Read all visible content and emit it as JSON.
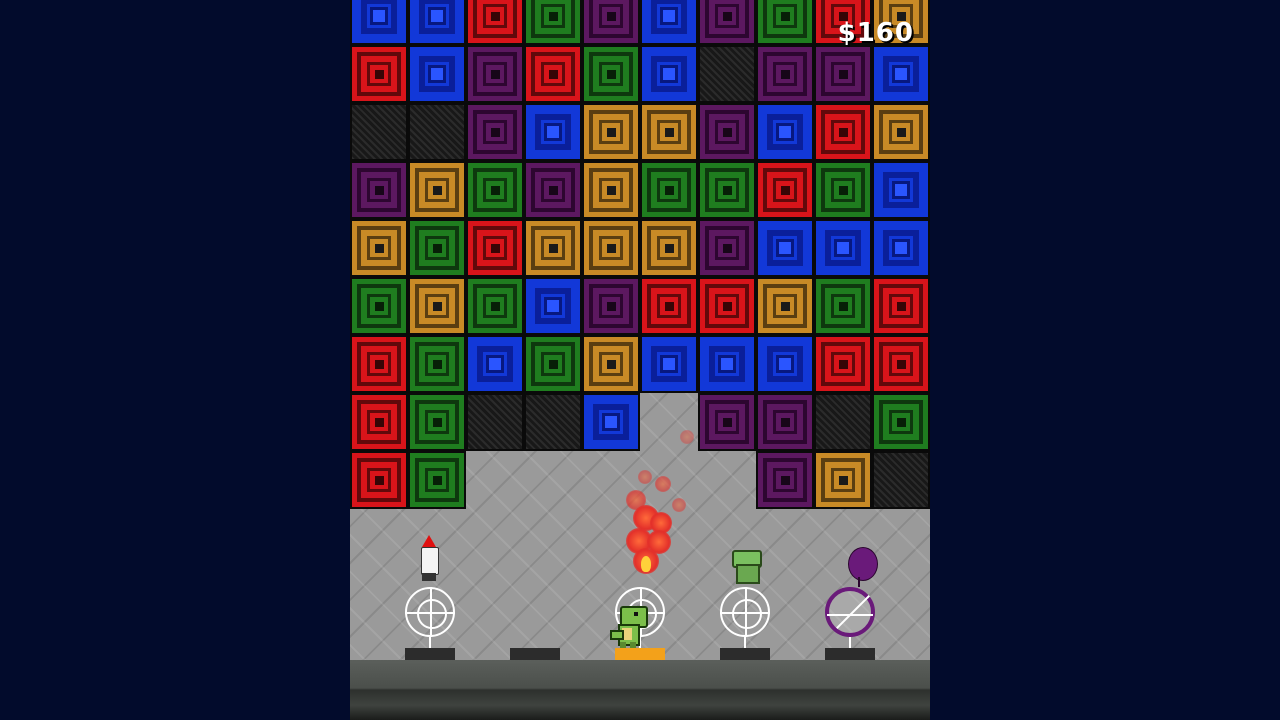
{
  "hud": {
    "money": "$160"
  },
  "tile_colors": {
    "r": "#d8141a",
    "g": "#1f7d1f",
    "b": "#1238d8",
    "p": "#5c1860",
    "o": "#c88a26",
    "x": "#1e1e1e"
  },
  "grid": [
    [
      "b",
      "b",
      "r",
      "g",
      "p",
      "b",
      "p",
      "g",
      "r",
      "o"
    ],
    [
      "r",
      "b",
      "p",
      "r",
      "g",
      "b",
      "x",
      "p",
      "p",
      "b"
    ],
    [
      "x",
      "x",
      "p",
      "b",
      "o",
      "o",
      "p",
      "b",
      "r",
      "o"
    ],
    [
      "p",
      "o",
      "g",
      "p",
      "o",
      "g",
      "g",
      "r",
      "g",
      "b"
    ],
    [
      "o",
      "g",
      "r",
      "o",
      "o",
      "o",
      "p",
      "b",
      "b",
      "b"
    ],
    [
      "g",
      "o",
      "g",
      "b",
      "p",
      "r",
      "r",
      "o",
      "g",
      "r"
    ],
    [
      "r",
      "g",
      "b",
      "g",
      "o",
      "b",
      "b",
      "b",
      "r",
      "r"
    ],
    [
      "r",
      "g",
      "x",
      "x",
      "b",
      "",
      "p",
      "p",
      "x",
      "g"
    ],
    [
      "r",
      "g",
      "",
      "",
      "",
      "",
      "",
      "p",
      "o",
      "x"
    ]
  ],
  "powerups": [
    {
      "name": "rocket-icon",
      "slot": 0
    },
    {
      "name": "empty-slot",
      "slot": 1
    },
    {
      "name": "fire-icon",
      "slot": 2
    },
    {
      "name": "fist-icon",
      "slot": 3
    },
    {
      "name": "balloon-icon",
      "slot": 4
    }
  ],
  "player": {
    "name": "dino-character",
    "slot": 2
  },
  "colors": {
    "background": "#020b2c",
    "active_slot": "#f3a11a"
  }
}
